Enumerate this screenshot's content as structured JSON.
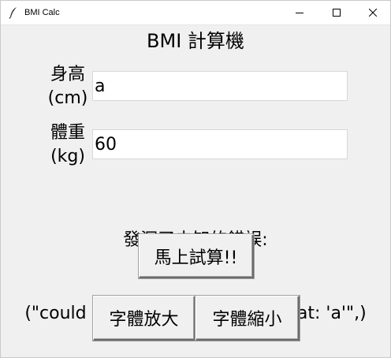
{
  "window": {
    "title": "BMI Calc"
  },
  "app": {
    "heading": "BMI 計算機"
  },
  "form": {
    "height_label_line1": "身高",
    "height_label_line2": "(cm)",
    "height_value": "a",
    "weight_label_line1": "體重",
    "weight_label_line2": "(kg)",
    "weight_value": "60"
  },
  "result": {
    "error_line1": "發深了未知的錯誤:",
    "error_line2": "(\"could not convert string to float: 'a'\",)"
  },
  "buttons": {
    "calculate": "馬上試算!!",
    "font_larger": "字體放大",
    "font_smaller": "字體縮小"
  },
  "icons": {
    "app": "feather-icon",
    "minimize": "minimize-icon",
    "maximize": "maximize-icon",
    "close": "close-icon"
  }
}
